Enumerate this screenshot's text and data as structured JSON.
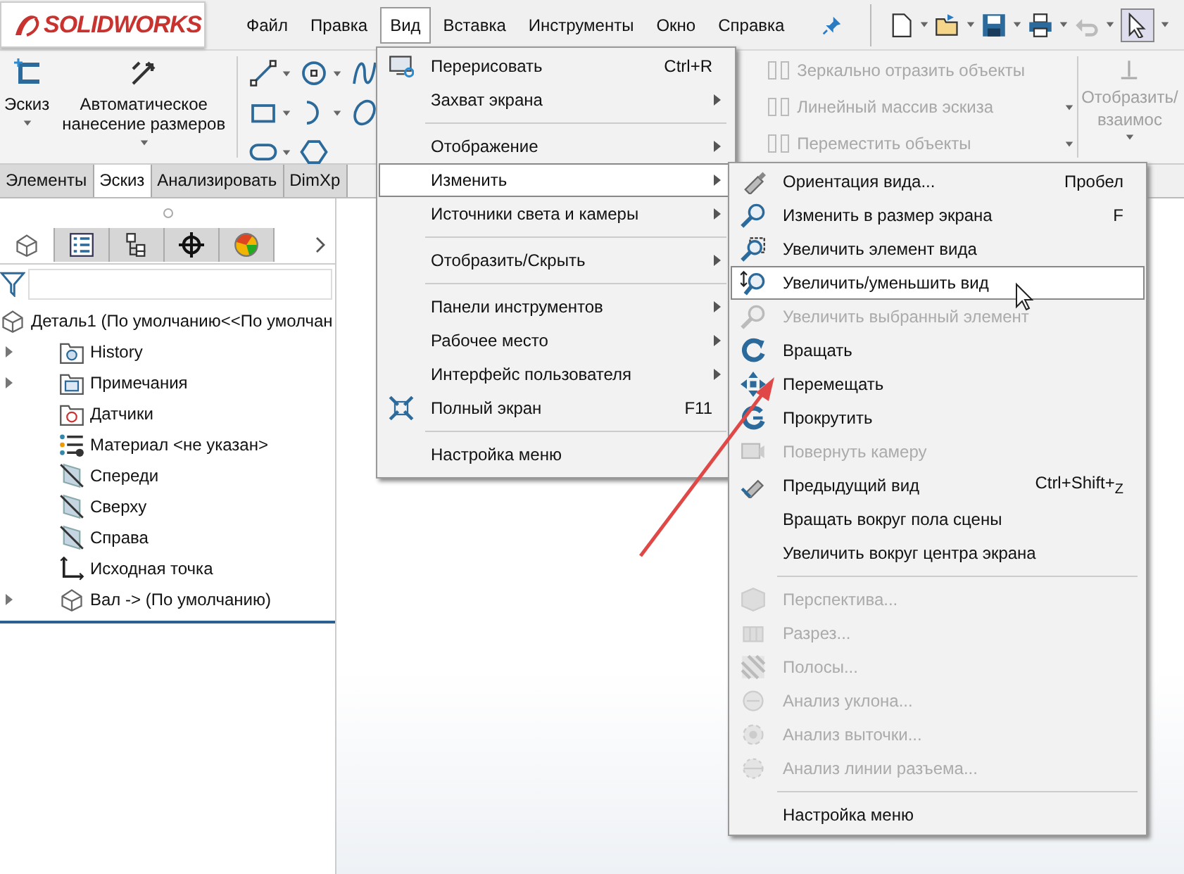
{
  "logo": {
    "text": "SOLIDWORKS"
  },
  "menubar": [
    {
      "label": "Файл",
      "selected": false
    },
    {
      "label": "Правка",
      "selected": false
    },
    {
      "label": "Вид",
      "selected": true
    },
    {
      "label": "Вставка",
      "selected": false
    },
    {
      "label": "Инструменты",
      "selected": false
    },
    {
      "label": "Окно",
      "selected": false
    },
    {
      "label": "Справка",
      "selected": false
    }
  ],
  "ribbon": {
    "sketch_button": "Эскиз",
    "dimension_button": "Автоматическое нанесение размеров",
    "disabled_commands": [
      "Зеркально отразить объекты",
      "Линейный массив эскиза",
      "Переместить объекты"
    ],
    "relations_button": [
      "Отобразить/",
      "взаимос"
    ]
  },
  "command_tabs": [
    {
      "label": "Элементы",
      "selected": false
    },
    {
      "label": "Эскиз",
      "selected": true
    },
    {
      "label": "Анализировать",
      "selected": false
    },
    {
      "label": "DimXp",
      "selected": false
    }
  ],
  "panel": {
    "icon_tabs": [
      {
        "kind": "tree",
        "selected": true
      },
      {
        "kind": "properties",
        "selected": false
      },
      {
        "kind": "configurations",
        "selected": false
      },
      {
        "kind": "target",
        "selected": false
      },
      {
        "kind": "appearance",
        "selected": false
      }
    ],
    "tree": {
      "label": "Деталь1  (По умолчанию<<По умолчан",
      "children": [
        {
          "label": "History",
          "kind": "history",
          "collapsed": true
        },
        {
          "label": "Примечания",
          "kind": "annotations",
          "collapsed": true
        },
        {
          "label": "Датчики",
          "kind": "sensors",
          "collapsed": false
        },
        {
          "label": "Материал <не указан>",
          "kind": "material",
          "collapsed": false
        },
        {
          "label": "Спереди",
          "kind": "plane",
          "collapsed": false
        },
        {
          "label": "Сверху",
          "kind": "plane",
          "collapsed": false
        },
        {
          "label": "Справа",
          "kind": "plane",
          "collapsed": false
        },
        {
          "label": "Исходная точка",
          "kind": "origin",
          "collapsed": false
        },
        {
          "label": "Вал -> (По умолчанию)",
          "kind": "part",
          "collapsed": true
        }
      ]
    }
  },
  "view_menu": [
    {
      "kind": "redraw",
      "label": "Перерисовать",
      "shortcut": "Ctrl+R",
      "submenu": false,
      "selected": false
    },
    {
      "kind": "plain",
      "label": "Захват экрана",
      "submenu": true,
      "selected": false
    },
    {
      "kind": "separator"
    },
    {
      "kind": "plain",
      "label": "Отображение",
      "submenu": true,
      "selected": false
    },
    {
      "kind": "plain",
      "label": "Изменить",
      "submenu": true,
      "selected": true
    },
    {
      "kind": "plain",
      "label": "Источники света и камеры",
      "submenu": true,
      "selected": false
    },
    {
      "kind": "separator"
    },
    {
      "kind": "plain",
      "label": "Отобразить/Скрыть",
      "submenu": true,
      "selected": false
    },
    {
      "kind": "separator"
    },
    {
      "kind": "plain",
      "label": "Панели инструментов",
      "submenu": true,
      "selected": false
    },
    {
      "kind": "plain",
      "label": "Рабочее место",
      "submenu": true,
      "selected": false
    },
    {
      "kind": "plain",
      "label": "Интерфейс пользователя",
      "submenu": true,
      "selected": false
    },
    {
      "kind": "fullscreen",
      "label": "Полный экран",
      "shortcut": "F11",
      "submenu": false,
      "selected": false
    },
    {
      "kind": "separator"
    },
    {
      "kind": "plain",
      "label": "Настройка меню",
      "submenu": false,
      "selected": false
    }
  ],
  "modify_submenu": [
    {
      "kind": "orientation",
      "label": "Ориентация вида...",
      "shortcut": "Пробел",
      "disabled": false,
      "selected": false
    },
    {
      "kind": "zoom-fit",
      "label": "Изменить в размер экрана",
      "shortcut": "F",
      "disabled": false,
      "selected": false
    },
    {
      "kind": "zoom-area",
      "label": "Увеличить элемент вида",
      "disabled": false,
      "selected": false
    },
    {
      "kind": "zoom-inout",
      "label": "Увеличить/уменьшить вид",
      "disabled": false,
      "selected": true
    },
    {
      "kind": "zoom-selection",
      "label": "Увеличить выбранный элемент",
      "disabled": true,
      "selected": false
    },
    {
      "kind": "rotate",
      "label": "Вращать",
      "disabled": false,
      "selected": false
    },
    {
      "kind": "pan",
      "label": "Перемещать",
      "disabled": false,
      "selected": false
    },
    {
      "kind": "roll",
      "label": "Прокрутить",
      "disabled": false,
      "selected": false
    },
    {
      "kind": "camera",
      "label": "Повернуть камеру",
      "disabled": true,
      "selected": false
    },
    {
      "kind": "previous",
      "label": "Предыдущий вид",
      "shortcut": "Ctrl+Shift+$_{Z}$",
      "disabled": false,
      "selected": false
    },
    {
      "kind": "plain",
      "label": "Вращать вокруг пола сцены",
      "disabled": false,
      "selected": false
    },
    {
      "kind": "plain",
      "label": "Увеличить вокруг центра экрана",
      "disabled": false,
      "selected": false
    },
    {
      "kind": "separator"
    },
    {
      "kind": "perspective",
      "label": "Перспектива...",
      "disabled": true,
      "selected": false
    },
    {
      "kind": "section",
      "label": "Разрез...",
      "disabled": true,
      "selected": false
    },
    {
      "kind": "zebra",
      "label": "Полосы...",
      "disabled": true,
      "selected": false
    },
    {
      "kind": "draft",
      "label": "Анализ уклона...",
      "disabled": true,
      "selected": false
    },
    {
      "kind": "undercut",
      "label": "Анализ выточки...",
      "disabled": true,
      "selected": false
    },
    {
      "kind": "parting",
      "label": "Анализ линии разъема...",
      "disabled": true,
      "selected": false
    },
    {
      "kind": "separator"
    },
    {
      "kind": "plain",
      "label": "Настройка меню",
      "disabled": false,
      "selected": false
    }
  ]
}
